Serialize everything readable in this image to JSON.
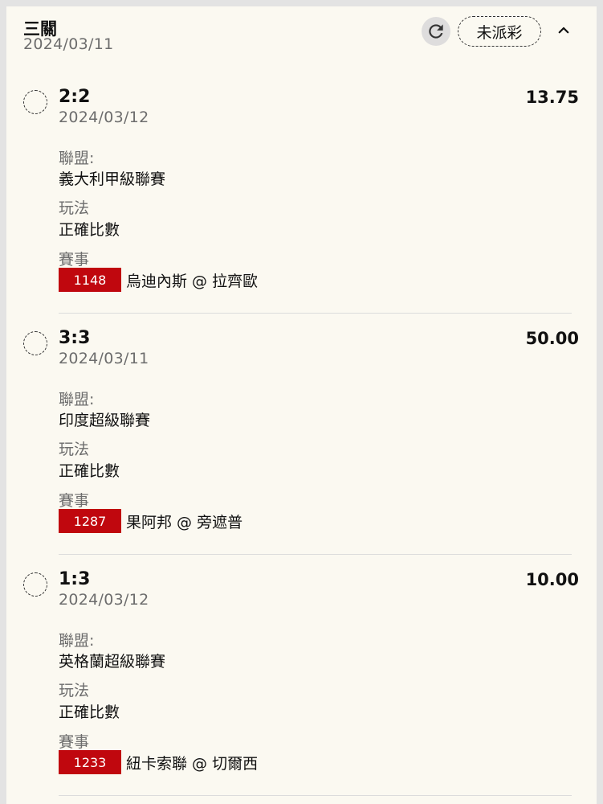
{
  "header": {
    "title": "三關",
    "date": "2024/03/11",
    "status": "未派彩",
    "refresh_icon": "refresh-icon",
    "collapse_icon": "chevron-up-icon"
  },
  "labels": {
    "league": "聯盟:",
    "play": "玩法",
    "match": "賽事"
  },
  "legs": [
    {
      "score": "2:2",
      "odds": "13.75",
      "date": "2024/03/12",
      "league": "義大利甲級聯賽",
      "play": "正確比數",
      "match_no": "1148",
      "teams": "烏迪內斯 @ 拉齊歐"
    },
    {
      "score": "3:3",
      "odds": "50.00",
      "date": "2024/03/11",
      "league": "印度超級聯賽",
      "play": "正確比數",
      "match_no": "1287",
      "teams": "果阿邦 @ 旁遮普"
    },
    {
      "score": "1:3",
      "odds": "10.00",
      "date": "2024/03/12",
      "league": "英格蘭超級聯賽",
      "play": "正確比數",
      "match_no": "1233",
      "teams": "紐卡索聯 @ 切爾西"
    }
  ],
  "colors": {
    "badge": "#c0070e",
    "card_bg": "#fbf9f1",
    "muted_text": "#6d6d6d"
  }
}
